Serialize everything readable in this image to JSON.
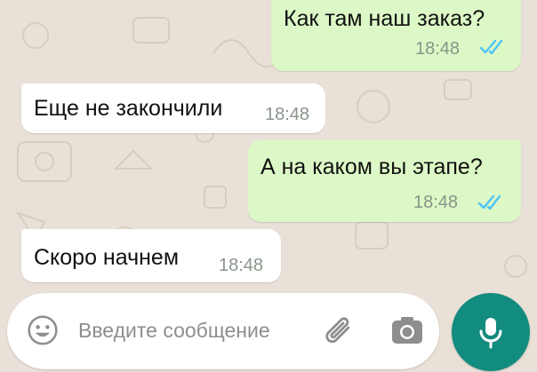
{
  "chat": {
    "messages": [
      {
        "direction": "outgoing",
        "text": "Как там наш заказ?",
        "time": "18:48",
        "status": "read"
      },
      {
        "direction": "incoming",
        "text": "Еще не закончили",
        "time": "18:48"
      },
      {
        "direction": "outgoing",
        "text": "А на каком вы этапе?",
        "time": "18:48",
        "status": "read"
      },
      {
        "direction": "incoming",
        "text": "Скоро начнем",
        "time": "18:48"
      }
    ]
  },
  "input": {
    "placeholder": "Введите сообщение",
    "emoji_icon": "emoji-icon",
    "attach_icon": "paperclip-icon",
    "camera_icon": "camera-icon"
  },
  "mic": {
    "icon": "microphone-icon"
  },
  "colors": {
    "outgoing_bubble": "#dcf8c6",
    "incoming_bubble": "#ffffff",
    "read_ticks": "#4fc3f7",
    "mic_button": "#128c7e",
    "wallpaper": "#e9e1d8"
  }
}
